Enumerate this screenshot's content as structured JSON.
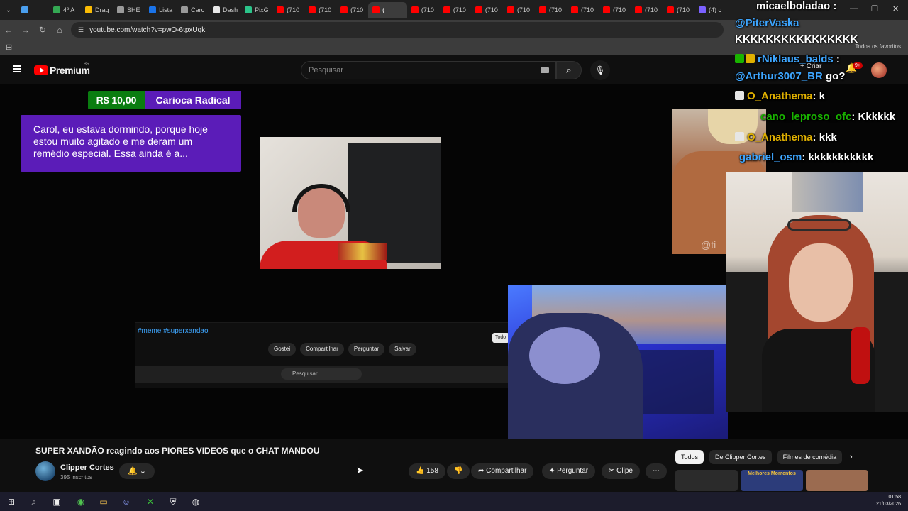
{
  "browser": {
    "tabs": [
      {
        "label": "",
        "color": "#4a9eed"
      },
      {
        "label": "4º A",
        "color": "#34a853"
      },
      {
        "label": "Drag",
        "color": "#fbbc05"
      },
      {
        "label": "SHE",
        "color": "#9a9a9a"
      },
      {
        "label": "Lista",
        "color": "#1a73e8"
      },
      {
        "label": "Carc",
        "color": "#9a9a9a"
      },
      {
        "label": "Dash",
        "color": "#e8e8e8"
      },
      {
        "label": "PixG",
        "color": "#2bc48a"
      },
      {
        "label": "(710",
        "color": "#ff0000"
      },
      {
        "label": "(710",
        "color": "#ff0000"
      },
      {
        "label": "(710",
        "color": "#ff0000"
      },
      {
        "label": "(",
        "color": "#ff0000",
        "active": true
      },
      {
        "label": "(710",
        "color": "#ff0000"
      },
      {
        "label": "(710",
        "color": "#ff0000"
      },
      {
        "label": "(710",
        "color": "#ff0000"
      },
      {
        "label": "(710",
        "color": "#ff0000"
      },
      {
        "label": "(710",
        "color": "#ff0000"
      },
      {
        "label": "(710",
        "color": "#ff0000"
      },
      {
        "label": "(710",
        "color": "#ff0000"
      },
      {
        "label": "(710",
        "color": "#ff0000"
      },
      {
        "label": "(710",
        "color": "#ff0000"
      },
      {
        "label": "(4) c",
        "color": "#7b61ff"
      }
    ],
    "url": "youtube.com/watch?v=pwO-6tpxUqk",
    "bookmarks_label": "Todos os favoritos"
  },
  "youtube": {
    "brand": "Premium",
    "country": "BR",
    "search_placeholder": "Pesquisar",
    "create_label": "Criar",
    "notif_count": "9+"
  },
  "video": {
    "superchat": {
      "amount": "R$ 10,00",
      "name": "Carioca Radical",
      "message": "Carol, eu estava dormindo, porque hoje estou muito agitado e me deram um remédio especial. Essa ainda é a...",
      "amount_color": "#0a7d10",
      "body_color": "#5b1cb8"
    },
    "inner_screen": {
      "tags": "#meme #superxandao",
      "actions": [
        "Gostei",
        "Compartilhar",
        "Perguntar",
        "Salvar"
      ],
      "search": "Pesquisar",
      "todo": "Todo"
    },
    "muscle_watermark": "@ti"
  },
  "chat": [
    {
      "user": "micaelboladao",
      "text": ":",
      "color": "#ffffff"
    },
    {
      "user": "@PiterVaska",
      "text": "",
      "color": "#3ea6ff"
    },
    {
      "user": "",
      "text": "KKKKKKKKKKKKKKKK",
      "color": "#ffffff"
    },
    {
      "user": "rNiklaus_balds",
      "text": ":",
      "color": "#3ea6ff"
    },
    {
      "user": "@Arthur3007_BR",
      "text": "go?",
      "color": "#3ea6ff"
    },
    {
      "user": "O_Anathema",
      "text": ": k",
      "color": "#e0b000"
    },
    {
      "user": "cano_leproso_ofc",
      "text": ": Kkkkkk",
      "color": "#19b400"
    },
    {
      "user": "O_Anathema",
      "text": ": kkk",
      "color": "#e0b000"
    },
    {
      "user": "gabriel_osm",
      "text": ": kkkkkkkkkkk",
      "color": "#3ea6ff"
    }
  ],
  "info": {
    "title": "SUPER XANDÃO reagindo aos PIORES VIDEOS que o CHAT MANDOU",
    "channel": "Clipper Cortes",
    "subscribers": "395 inscritos",
    "likes": "158",
    "share": "Compartilhar",
    "ask": "Perguntar",
    "clip": "Clipe",
    "chips": [
      "Todos",
      "De Clipper Cortes",
      "Filmes de comédia"
    ],
    "related_thumb_text": "Melhores Momentos"
  },
  "taskbar": {
    "time": "01:58",
    "date": "21/03/2026"
  }
}
